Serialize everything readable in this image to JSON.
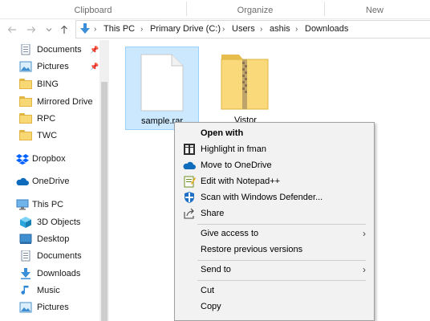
{
  "ribbon": {
    "groups": [
      "Clipboard",
      "Organize",
      "New"
    ]
  },
  "nav": {
    "back_icon": "arrow-left-icon",
    "forward_icon": "arrow-right-icon",
    "recent_icon": "chevron-down-icon",
    "up_icon": "arrow-up-icon"
  },
  "address": {
    "segments": [
      "This PC",
      "Primary Drive (C:)",
      "Users",
      "ashis",
      "Downloads"
    ],
    "icon": "download-arrow-icon"
  },
  "sidebar": {
    "items": [
      {
        "label": "Documents",
        "icon": "documents-icon",
        "pinned": true
      },
      {
        "label": "Pictures",
        "icon": "pictures-icon",
        "pinned": true
      },
      {
        "label": "BING",
        "icon": "folder-icon"
      },
      {
        "label": "Mirrored Drive",
        "icon": "folder-icon"
      },
      {
        "label": "RPC",
        "icon": "folder-icon"
      },
      {
        "label": "TWC",
        "icon": "folder-icon"
      },
      {
        "label": "Dropbox",
        "icon": "dropbox-icon"
      },
      {
        "label": "OneDrive",
        "icon": "onedrive-icon"
      },
      {
        "label": "This PC",
        "icon": "computer-icon"
      },
      {
        "label": "3D Objects",
        "icon": "3d-objects-icon"
      },
      {
        "label": "Desktop",
        "icon": "desktop-icon"
      },
      {
        "label": "Documents",
        "icon": "documents-icon"
      },
      {
        "label": "Downloads",
        "icon": "downloads-icon"
      },
      {
        "label": "Music",
        "icon": "music-icon"
      },
      {
        "label": "Pictures",
        "icon": "pictures-icon"
      }
    ]
  },
  "files": [
    {
      "name": "sample.rar",
      "icon": "blank-file-icon",
      "selected": true
    },
    {
      "name": "Vistor",
      "icon": "zip-folder-icon",
      "selected": false
    }
  ],
  "context_menu": {
    "items": [
      {
        "label": "Open with",
        "bold": true
      },
      {
        "label": "Highlight in fman",
        "icon": "fman-icon"
      },
      {
        "label": "Move to OneDrive",
        "icon": "onedrive-icon"
      },
      {
        "label": "Edit with Notepad++",
        "icon": "notepad-plus-plus-icon"
      },
      {
        "label": "Scan with Windows Defender...",
        "icon": "windows-defender-icon"
      },
      {
        "label": "Share",
        "icon": "share-icon"
      },
      {
        "label": "Give access to",
        "submenu": true
      },
      {
        "label": "Restore previous versions"
      },
      {
        "label": "Send to",
        "submenu": true
      },
      {
        "label": "Cut"
      },
      {
        "label": "Copy"
      }
    ],
    "submenu_glyph": "›"
  }
}
